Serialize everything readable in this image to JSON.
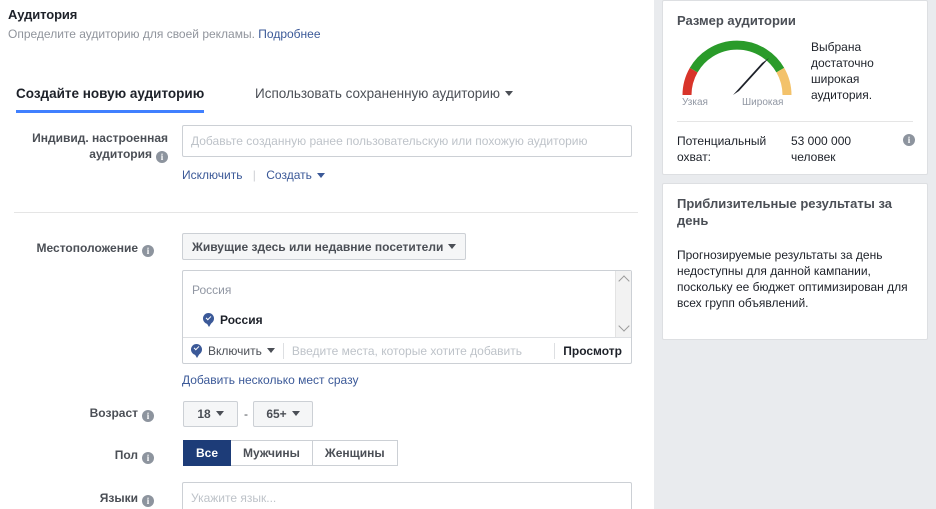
{
  "section": {
    "title": "Аудитория",
    "subtitle": "Определите аудиторию для своей рекламы.",
    "subtitle_link": "Подробнее"
  },
  "tabs": [
    {
      "label": "Создайте новую аудиторию",
      "active": true
    },
    {
      "label": "Использовать сохраненную аудиторию",
      "active": false
    }
  ],
  "custom_audience": {
    "label_line1": "Индивид. настроенная",
    "label_line2": "аудитория",
    "placeholder": "Добавьте созданную ранее пользовательскую или похожую аудиторию",
    "exclude_link": "Исключить",
    "create_link": "Создать"
  },
  "location": {
    "label": "Местоположение",
    "mode": "Живущие здесь или недавние посетители",
    "group_header": "Россия",
    "selected_item": "Россия",
    "include_label": "Включить",
    "places_placeholder": "Введите места, которые хотите добавить",
    "preview_label": "Просмотр",
    "bulk_link": "Добавить несколько мест сразу"
  },
  "age": {
    "label": "Возраст",
    "min": "18",
    "max": "65+",
    "separator": "-"
  },
  "gender": {
    "label": "Пол",
    "options": [
      {
        "label": "Все",
        "selected": true
      },
      {
        "label": "Мужчины",
        "selected": false
      },
      {
        "label": "Женщины",
        "selected": false
      }
    ]
  },
  "languages": {
    "label": "Языки",
    "placeholder": "Укажите язык..."
  },
  "audience_size_card": {
    "title": "Размер аудитории",
    "gauge_low_label": "Узкая",
    "gauge_high_label": "Широкая",
    "verdict": "Выбрана достаточно широкая аудитория.",
    "reach_label": "Потенциальный охват:",
    "reach_value": "53 000 000 человек"
  },
  "daily_results_card": {
    "title": "Приблизительные результаты за день",
    "body": "Прогнозируемые результаты за день недоступны для данной кампании, поскольку ее бюджет оптимизирован для всех групп объявлений."
  },
  "colors": {
    "accent_blue": "#4080ff",
    "link_blue": "#3b5998",
    "selected_navy": "#1d3c78",
    "gauge_red": "#d8342a",
    "gauge_green": "#2a9b2a",
    "gauge_orange": "#f3c26b",
    "rail_bg": "#e9ebee"
  },
  "icons": {
    "info": "i",
    "map_pin": "map-pin-icon",
    "caret_down": "chevron-down-icon",
    "scroll_up": "chevron-up-icon",
    "scroll_down": "chevron-down-icon"
  }
}
